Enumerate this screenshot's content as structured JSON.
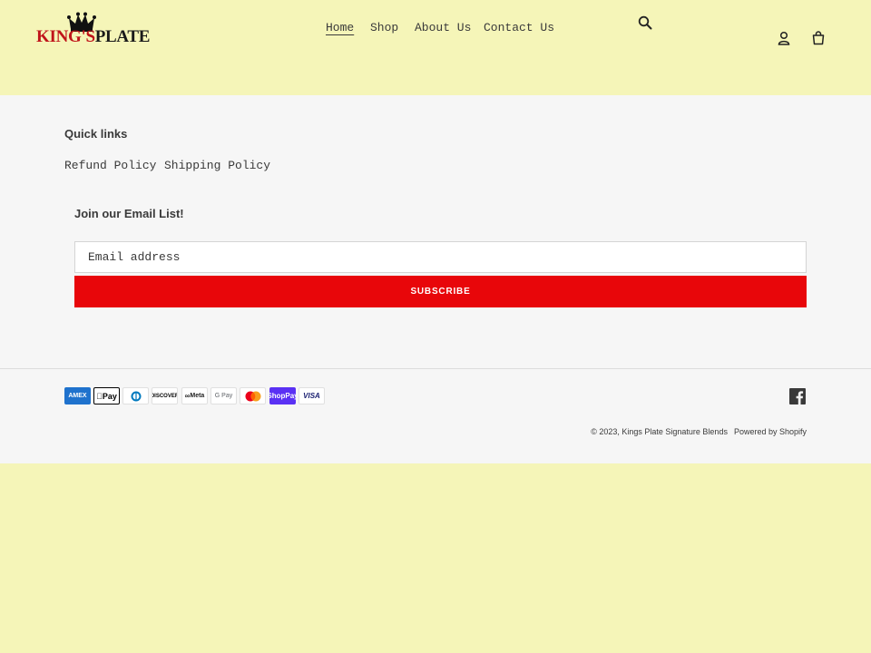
{
  "brand": {
    "logo_part1": "KING'S",
    "logo_part2": "PLATE",
    "colors": {
      "red": "#c0141a",
      "dark": "#1a1a1a"
    }
  },
  "header": {
    "nav": [
      {
        "label": "Home",
        "active": true
      },
      {
        "label": "Shop"
      },
      {
        "label": "About Us"
      },
      {
        "label": "Contact Us"
      }
    ],
    "icons": [
      "search-icon",
      "account-icon",
      "cart-icon"
    ],
    "background": "#f5f5b8"
  },
  "footer": {
    "quick_links_title": "Quick links",
    "quick_links": [
      "Refund Policy",
      "Shipping Policy"
    ],
    "email_title": "Join our Email List!",
    "email_placeholder": "Email address",
    "subscribe_label": "SUBSCRIBE",
    "subscribe_color": "#e8060a",
    "payments": [
      "AMEX",
      "Pay",
      "Diners",
      "DISCOVER",
      "Meta",
      "G Pay",
      "Mastercard",
      "Pay",
      "VISA"
    ],
    "social": [
      "facebook-icon"
    ],
    "copyright": "© 2023, Kings Plate Signature Blends",
    "powered_by": "Powered by Shopify",
    "background": "#f6f6f6"
  }
}
